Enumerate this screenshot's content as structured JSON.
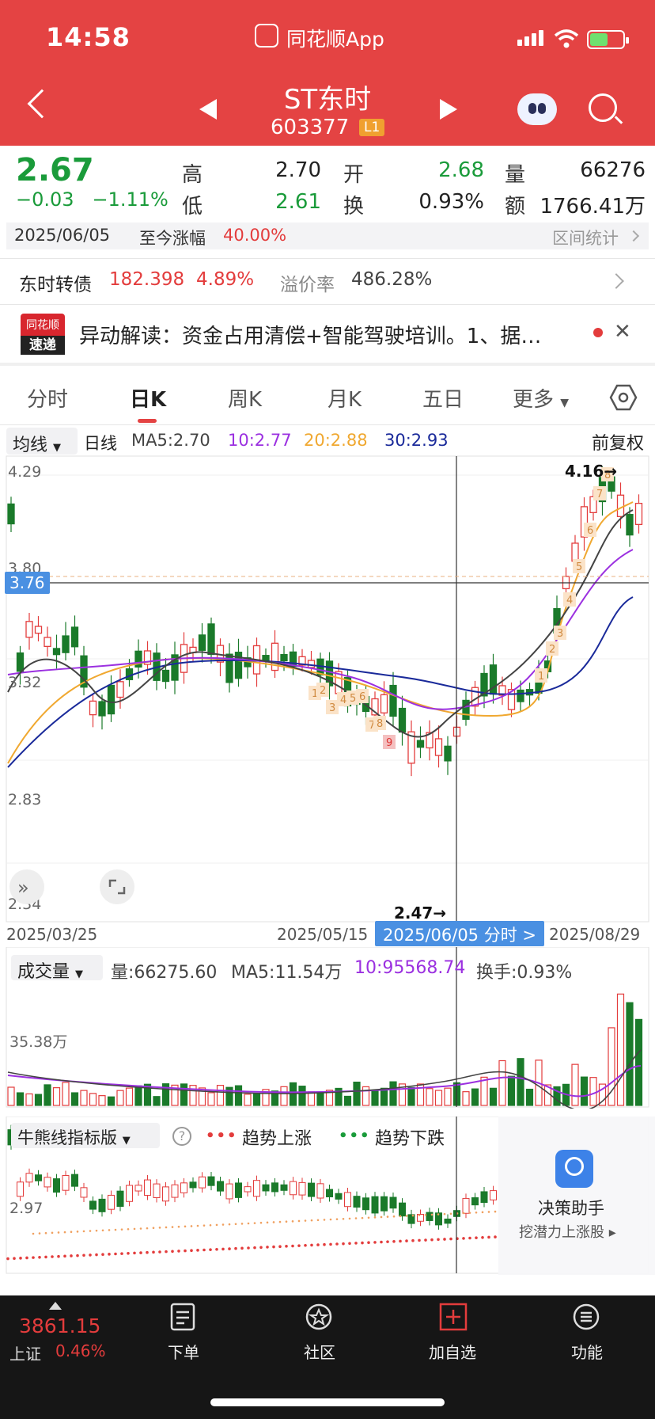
{
  "status": {
    "time": "14:58",
    "app_name": "同花顺App"
  },
  "header": {
    "name": "ST东时",
    "code": "603377",
    "badge": "L1"
  },
  "quote": {
    "price": "2.67",
    "change": "−0.03",
    "change_pct": "−1.11%",
    "labels": {
      "high": "高",
      "low": "低",
      "open": "开",
      "turnover": "换",
      "volume": "量",
      "amount": "额"
    },
    "high": "2.70",
    "low": "2.61",
    "open": "2.68",
    "turnover": "0.93%",
    "volume": "66276",
    "amount": "1766.41万"
  },
  "date_bar": {
    "date": "2025/06/05",
    "label": "至今涨幅",
    "value": "40.00%",
    "right": "区间统计"
  },
  "cb": {
    "label": "东时转债",
    "price": "182.398",
    "pct": "4.89%",
    "premium_label": "溢价率",
    "premium": "486.28%"
  },
  "news": {
    "logo_top": "同花顺",
    "logo_bottom": "速递",
    "text": "异动解读：资金占用清偿+智能驾驶培训。1、据…",
    "close": "✕"
  },
  "tabs": [
    "分时",
    "日K",
    "周K",
    "月K",
    "五日",
    "更多"
  ],
  "ma": {
    "dropdown": "均线",
    "period": "日线",
    "ma5": "MA5:2.70",
    "ma10": "10:2.77",
    "ma20": "20:2.88",
    "ma30": "30:2.93",
    "adjust": "前复权",
    "colors": {
      "ma5": "#444444",
      "ma10": "#9b30e0",
      "ma20": "#f0a830",
      "ma30": "#1a2a9a"
    }
  },
  "kchart": {
    "y_labels": [
      "4.29",
      "3.80",
      "3.32",
      "2.83",
      "2.34"
    ],
    "crosshair_price": "3.76",
    "high_marker": "4.16→",
    "low_marker": "2.47→",
    "dates": [
      "2025/03/25",
      "2025/05/15",
      "2025/08/29"
    ],
    "selected_date": "2025/06/05 分时 >",
    "up_color": "#e33c3c",
    "down_color": "#1a7a2a",
    "sequence_numbers": [
      "1",
      "2",
      "3",
      "4",
      "5",
      "6",
      "7",
      "8",
      "9",
      "1",
      "2",
      "3",
      "4",
      "5",
      "6",
      "7",
      "8"
    ]
  },
  "volume": {
    "dropdown": "成交量",
    "vol": "量:66275.60",
    "ma5": "MA5:11.54万",
    "ma10": "10:95568.74",
    "turnover": "换手:0.93%",
    "scale": "35.38万"
  },
  "bear": {
    "dropdown": "牛熊线指标版",
    "help": "?",
    "up_dots": "•••",
    "up_label": "趋势上涨",
    "down_dots": "•••",
    "down_label": "趋势下跌",
    "scale": "2.97"
  },
  "assistant": {
    "title": "决策助手",
    "subtitle": "挖潜力上涨股 ▸"
  },
  "bottom": {
    "index_value": "3861.15",
    "index_name": "上证",
    "index_pct": "0.46%",
    "items": [
      "下单",
      "社区",
      "加自选",
      "功能"
    ]
  }
}
